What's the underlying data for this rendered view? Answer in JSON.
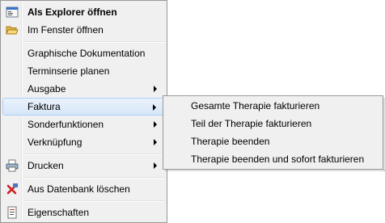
{
  "main_menu": {
    "items": [
      {
        "label": "Als Explorer öffnen",
        "icon": "explorer-icon"
      },
      {
        "label": "Im Fenster öffnen",
        "icon": "folder-open-icon"
      },
      {
        "label": "Graphische Dokumentation"
      },
      {
        "label": "Terminserie planen"
      },
      {
        "label": "Ausgabe"
      },
      {
        "label": "Faktura"
      },
      {
        "label": "Sonderfunktionen"
      },
      {
        "label": "Verknüpfung"
      },
      {
        "label": "Drucken",
        "icon": "printer-icon"
      },
      {
        "label": "Aus Datenbank löschen",
        "icon": "delete-icon"
      },
      {
        "label": "Eigenschaften",
        "icon": "properties-icon"
      }
    ]
  },
  "sub_menu": {
    "items": [
      {
        "label": "Gesamte Therapie fakturieren"
      },
      {
        "label": "Teil der Therapie fakturieren"
      },
      {
        "label": "Therapie beenden"
      },
      {
        "label": "Therapie beenden und sofort fakturieren"
      }
    ]
  }
}
